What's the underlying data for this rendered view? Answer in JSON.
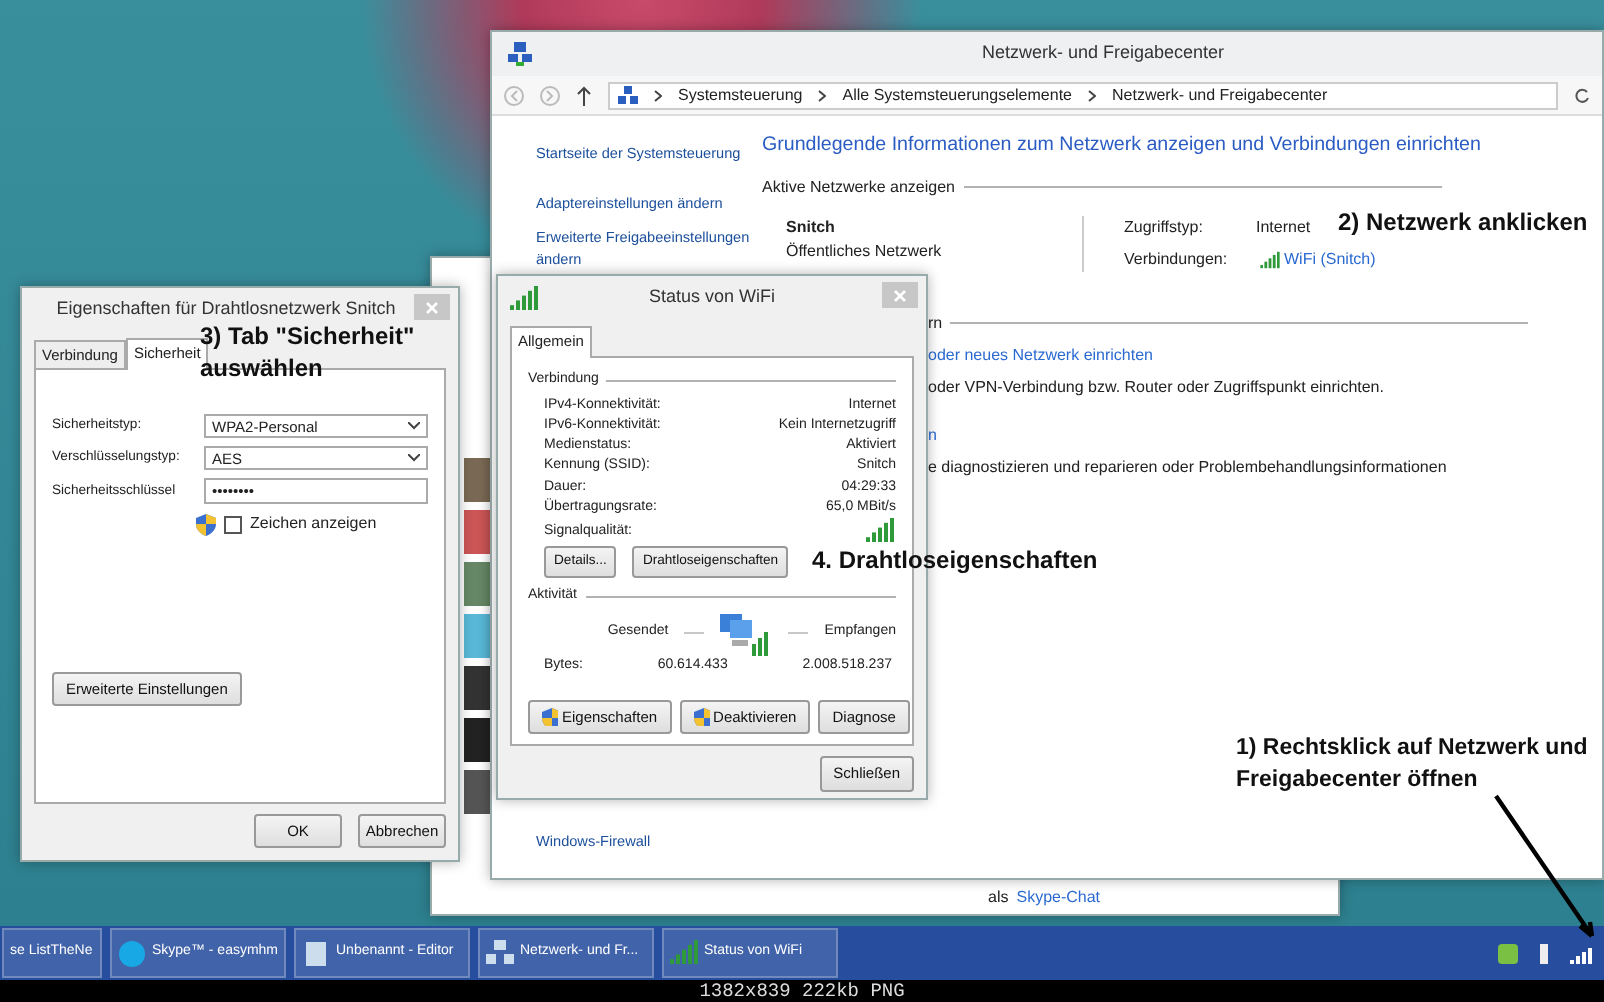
{
  "network_center": {
    "title": "Netzwerk- und Freigabecenter",
    "breadcrumb": [
      "Systemsteuerung",
      "Alle Systemsteuerungselemente",
      "Netzwerk- und Freigabecenter"
    ],
    "sidebar_links": [
      "Startseite der Systemsteuerung",
      "Adaptereinstellungen ändern",
      "Erweiterte Freigabeeinstellungen ändern"
    ],
    "heading": "Grundlegende Informationen zum Netzwerk anzeigen und Verbindungen einrichten",
    "active_networks_label": "Aktive Netzwerke anzeigen",
    "network_name": "Snitch",
    "network_type": "Öffentliches Netzwerk",
    "access_type_label": "Zugriffstyp:",
    "access_type": "Internet",
    "connections_label": "Verbindungen:",
    "connection_link": "WiFi (Snitch)",
    "settings_label": "rn",
    "partial_texts": [
      {
        "kind": "link",
        "text": "oder neues Netzwerk einrichten"
      },
      {
        "kind": "text",
        "text": "oder VPN-Verbindung bzw. Router oder Zugriffspunkt einrichten."
      },
      {
        "kind": "link",
        "text": "n"
      },
      {
        "kind": "text",
        "text": "e diagnostizieren und reparieren oder Problembehandlungsinformationen"
      }
    ],
    "bottom_link": "Windows-Firewall"
  },
  "skype": {
    "chat_prefix": "als",
    "chat_link": "Skype-Chat"
  },
  "properties_dialog": {
    "title": "Eigenschaften für Drahtlosnetzwerk Snitch",
    "tabs": [
      {
        "label": "Verbindung",
        "selected": false
      },
      {
        "label": "Sicherheit",
        "selected": true
      }
    ],
    "fields": [
      {
        "kind": "select",
        "label": "Sicherheitstyp:",
        "value": "WPA2-Personal"
      },
      {
        "kind": "select",
        "label": "Verschlüsselungstyp:",
        "value": "AES"
      },
      {
        "kind": "password",
        "label": "Sicherheitsschlüssel",
        "value": "••••••••"
      }
    ],
    "show_characters": {
      "label": "Zeichen anzeigen",
      "checked": false
    },
    "advanced_button": "Erweiterte Einstellungen",
    "buttons": [
      "OK",
      "Abbrechen"
    ]
  },
  "status_dialog": {
    "title": "Status von WiFi",
    "tabs": [
      {
        "label": "Allgemein",
        "selected": true
      }
    ],
    "connection_group": "Verbindung",
    "rows": [
      {
        "label": "IPv4-Konnektivität:",
        "value": "Internet"
      },
      {
        "label": "IPv6-Konnektivität:",
        "value": "Kein Internetzugriff"
      },
      {
        "label": "Medienstatus:",
        "value": "Aktiviert"
      },
      {
        "label": "Kennung (SSID):",
        "value": "Snitch"
      },
      {
        "label": "Dauer:",
        "value": "04:29:33"
      },
      {
        "label": "Übertragungsrate:",
        "value": "65,0 MBit/s"
      }
    ],
    "signal_label": "Signalqualität:",
    "top_buttons": [
      "Details...",
      "Drahtloseigenschaften"
    ],
    "activity_group": "Aktivität",
    "sent_label": "Gesendet",
    "received_label": "Empfangen",
    "bytes_label": "Bytes:",
    "bytes_sent": "60.614.433",
    "bytes_received": "2.008.518.237",
    "bottom_buttons": [
      {
        "label": "Eigenschaften",
        "shield": true
      },
      {
        "label": "Deaktivieren",
        "shield": true
      },
      {
        "label": "Diagnose",
        "shield": false
      }
    ],
    "close_button": "Schließen"
  },
  "annotations": [
    "3) Tab \"Sicherheit\" auswählen",
    "2) Netzwerk anklicken",
    "4. Drahtloseigenschaften",
    "1) Rechtsklick auf Netzwerk und Freigabecenter öffnen"
  ],
  "taskbar": {
    "items": [
      {
        "kind": "generic",
        "label": "se ListTheNe"
      },
      {
        "kind": "skype",
        "label": "Skype™ - easymhm"
      },
      {
        "kind": "editor",
        "label": "Unbenannt - Editor"
      },
      {
        "kind": "network",
        "label": "Netzwerk- und Fr..."
      },
      {
        "kind": "signal",
        "label": "Status von WiFi"
      }
    ]
  },
  "caption": "1382x839 222kb PNG"
}
